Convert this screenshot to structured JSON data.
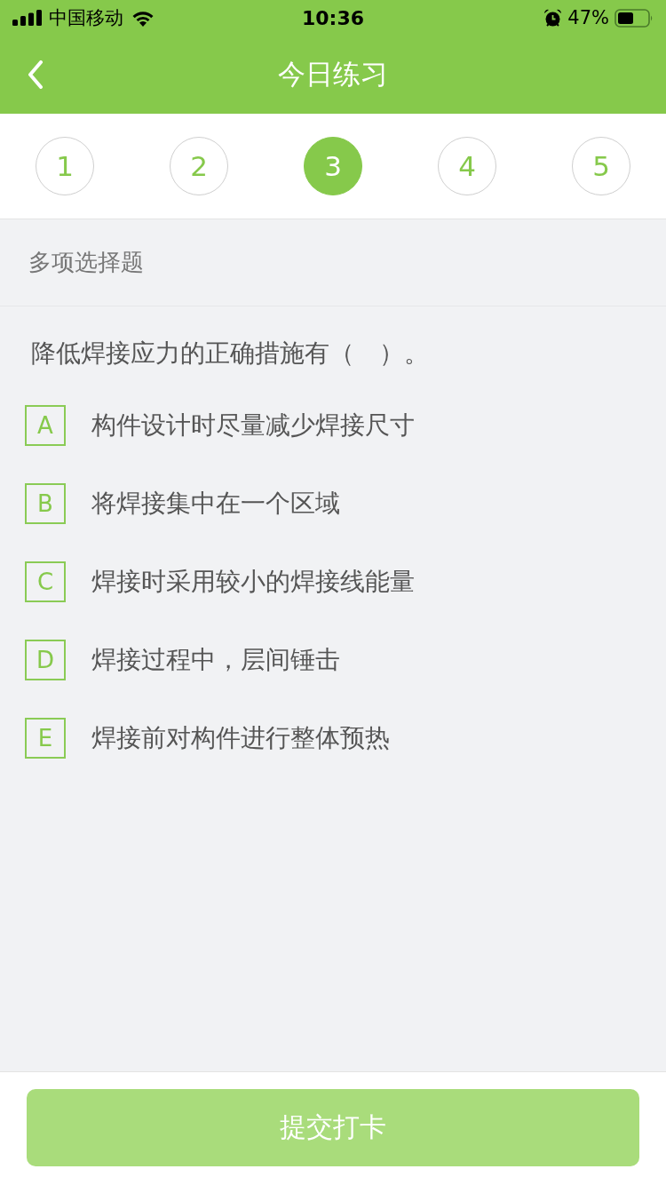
{
  "status_bar": {
    "carrier": "中国移动",
    "time": "10:36",
    "battery_percent": "47%"
  },
  "nav_bar": {
    "title": "今日练习"
  },
  "question_tabs": [
    {
      "label": "1",
      "selected": false
    },
    {
      "label": "2",
      "selected": false
    },
    {
      "label": "3",
      "selected": true
    },
    {
      "label": "4",
      "selected": false
    },
    {
      "label": "5",
      "selected": false
    }
  ],
  "question_type": "多项选择题",
  "question": {
    "text": "降低焊接应力的正确措施有（　）。",
    "options": [
      {
        "letter": "A",
        "text": "构件设计时尽量减少焊接尺寸",
        "selected": false
      },
      {
        "letter": "B",
        "text": "将焊接集中在一个区域",
        "selected": false
      },
      {
        "letter": "C",
        "text": "焊接时采用较小的焊接线能量",
        "selected": false
      },
      {
        "letter": "D",
        "text": "焊接过程中，层间锤击",
        "selected": false
      },
      {
        "letter": "E",
        "text": "焊接前对构件进行整体预热",
        "selected": false
      }
    ]
  },
  "submit_button": {
    "label": "提交打卡",
    "disabled": true
  }
}
